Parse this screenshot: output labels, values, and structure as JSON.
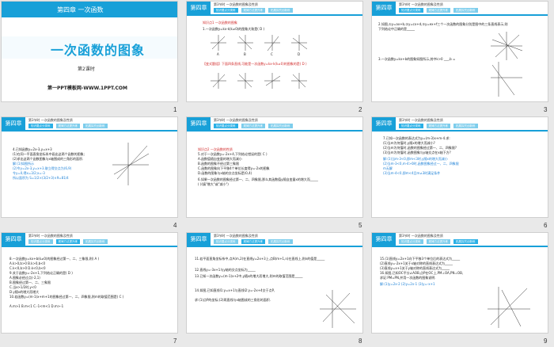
{
  "slides": [
    {
      "num": "1",
      "subject": "第四章  一次函数",
      "title": "一次函数的图象",
      "lesson": "第2课时",
      "site": "第一PPT模板网-WWW.1PPT.COM"
    },
    {
      "num": "2",
      "chapter": "第四章",
      "section": "第3节时  一次函数的图象及性质",
      "tabs": [
        "知识要点分类练",
        "规律方法提升练",
        "拓展探究创新练"
      ],
      "lines": [
        "知识点1  一次函数的图象",
        "1.一次函数y=kx-k(k≠0)的图象大致是( D )",
        "【变式题组】下面四条直线,可能是一次函数y=kx-k(k≠0)的图象的是( D )"
      ],
      "opts": [
        "A",
        "B",
        "C",
        "D"
      ]
    },
    {
      "num": "3",
      "lines": [
        "2.如图,①y=ax+b,②y=cx+d,③y=ex+f三个一次函数的图象分别是图中的三条直线表示,则",
        "下列结论中正确的是_____",
        "3.一次函数y=kx+b的图象如图所示,其中k>0 ___,b ="
      ]
    },
    {
      "num": "4",
      "chapter": "第四章",
      "section": "第3节时  一次函数的图象及性质",
      "lines": [
        "4.已知函数y=2x-3,y=x+3",
        "(1)在同一平面直角坐标系中画出这两个函数的图象;",
        "(2)求出这两个函数图象与x轴围成的三角形的面积.",
        "解:(1)如图所示",
        "(2)令y=2x-3,y=x+3.联立得交点为(6,9)",
        "令y=0,得x=3/2;x=-3",
        "所以面积为 S=1/2×(3/2+3)×9=81/4"
      ]
    },
    {
      "num": "5",
      "chapter": "第四章",
      "section": "第3节时  一次函数的图象及性质",
      "lines": [
        "知识点2  一次函数的性质",
        "5.对于一次函数y=-2x+4,下列结论错误的是( C )",
        "A.函数值随自变量的增大而减小",
        "B.函数的图象不经过第三象限",
        "C.函数的图象向下平移4个单位长度得y=-2x的图象",
        "D.函数的图象与x轴的交点坐标是(0,4)",
        "6.如果一次函数的图象经过第一、二、四象限,那么其函数值y随自变量x的增大而_____",
        "(  )(填\"增大\"或\"减小\")"
      ]
    },
    {
      "num": "6",
      "chapter": "第四章",
      "section": "第3节时  一次函数的图象及性质",
      "lines": [
        "7.已知一次函数的表达式为y=(m-3)x+m-4.求:",
        "(1)当m为何值时,y随x的增大而减小?",
        "(2)当m为何值时,函数的图象经过第一、二、四象限?",
        "(3)当m为何值时,函数图象与y轴交点在x轴下方?",
        "解:(1)当m-3<0,即m<3时,y随x的增大而减小",
        "(2)当m-3<0,m-4>0时,函数图象经过一、二、四象限",
        "m无解",
        "(3)当m-4<0,即m<4且m≠3时满足条件"
      ]
    },
    {
      "num": "7",
      "chapter": "第四章",
      "section": "第3节时  一次函数的图象及性质",
      "lines": [
        "8.一次函数y=kx+b(k≠0)的图象经过第一、二、三象限,则( A )",
        "A.k>0,b>0    B.k>0,b<0",
        "C.k<0,b>0    D.k<0,b<0",
        "9.关于函数y=-2x+1,下列结论正确的是( D )",
        "A.图象必经过点(-2,1)",
        "B.图象经过第一、二、三象限",
        "C.当x>1/2时,y<0",
        "D.y随x的增大而增大",
        "10.若函数y=(m-1)x+m+1的图象经过第一、二、四象限,则m的取值范围是( C )",
        "A.m>1    B.m<1    C.-1<m<1    D.m>-1"
      ]
    },
    {
      "num": "8",
      "chapter": "第四章",
      "section": "第3节时  一次函数的图象及性质",
      "lines": [
        "11.若平面直角坐标系中,点A(m,2)在直线y=2x+3上,点B(m+1,n)在直线上,则n的值是_____",
        "12.直线y=-3x+1与y轴的交点坐标为_____",
        "13.已知一次函数y=(m-1)x+2中,y随x的增大而增大,则m的取值范围是_____",
        "14.如图,已知直线l1:y=x+1与直线l2:y=-2x+4交于点P,",
        "求:(1)点P的坐标;(2)两直线与x轴围成的三角形的面积."
      ]
    },
    {
      "num": "9",
      "chapter": "第四章",
      "section": "第3节时  一次函数的图象及性质",
      "lines": [
        "15.(1)直线y=2x+1向下平移3个单位后的表达式为_____",
        "(2)直线y=-2x+1关于x轴对称的直线表达式为_____",
        "(3)直线y=x+1关于y轴对称的直线表达式为_____",
        "16.如图,已知OC平分∠AOB,点P在OC上,PM⊥OA,PN⊥OB,",
        "求证:PM=PN,并用一次函数的图象说明.",
        "解:(1)y=2x-2  (2)y=2x-1  (3)y=-x+1"
      ]
    }
  ],
  "colors": {
    "accent": "#18a0d8",
    "red": "#d12a2a",
    "blue": "#1a7fd6"
  }
}
